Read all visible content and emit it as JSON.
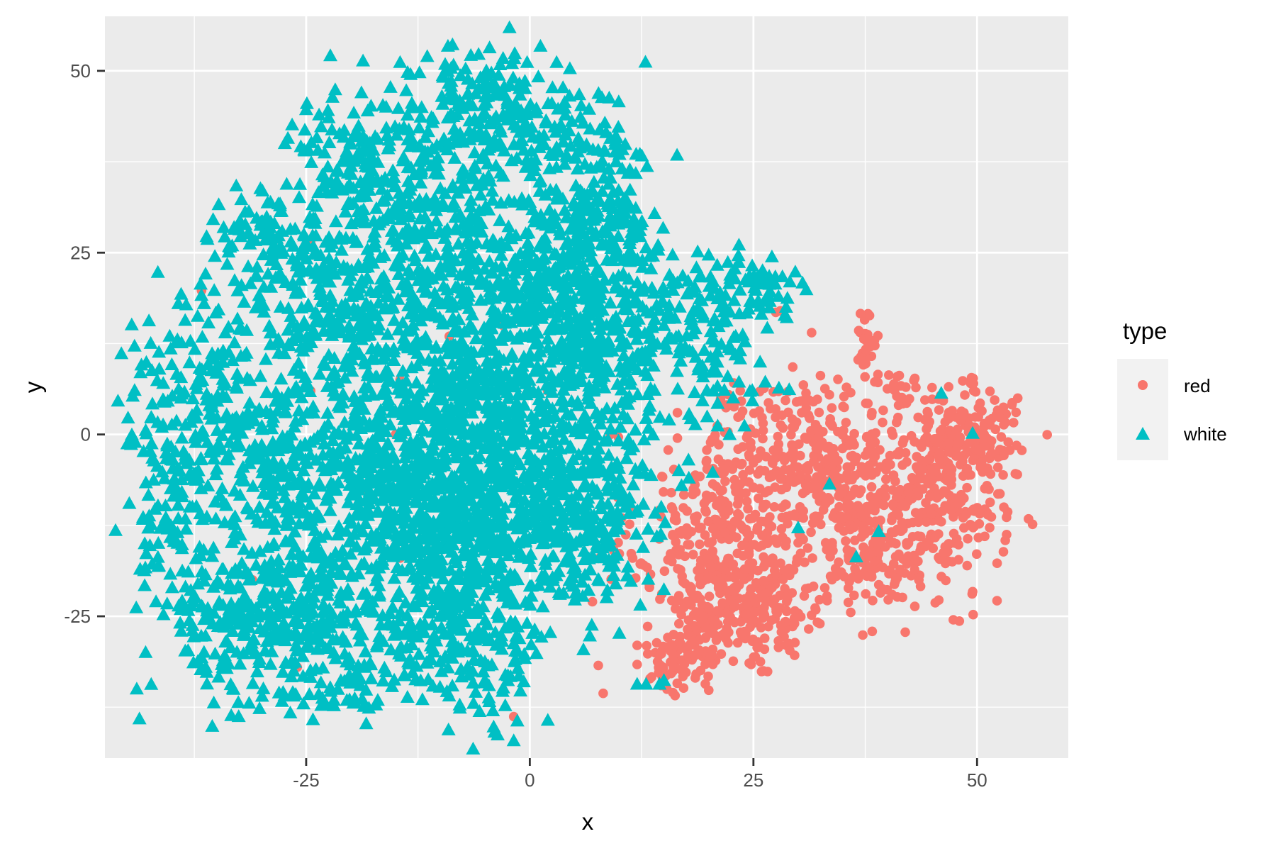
{
  "chart_data": {
    "type": "scatter",
    "title": "",
    "xlabel": "x",
    "ylabel": "y",
    "xlim": [
      -47.5,
      60.2
    ],
    "ylim": [
      -44.5,
      57.5
    ],
    "x_ticks": [
      -25,
      0,
      25,
      50
    ],
    "y_ticks": [
      -25,
      0,
      25,
      50
    ],
    "x_tick_labels": [
      "-25",
      "0",
      "25",
      "50"
    ],
    "y_tick_labels": [
      "-25",
      "0",
      "25",
      "50"
    ],
    "grid": true,
    "legend": {
      "title": "type",
      "placement": "right",
      "entries": [
        {
          "label": "red",
          "shape": "circle",
          "color": "#F8766D"
        },
        {
          "label": "white",
          "shape": "triangle",
          "color": "#00BFC4"
        }
      ]
    },
    "colors": {
      "red": "#F8766D",
      "white": "#00BFC4",
      "panel": "#EBEBEB",
      "grid": "#FFFFFF"
    },
    "series": [
      {
        "name": "red",
        "shape": "circle",
        "approx_count": 1599,
        "clusters": [
          {
            "cx": 22,
            "cy": -14,
            "sx": 5,
            "sy": 7,
            "n": 330
          },
          {
            "cx": 24,
            "cy": -24,
            "sx": 4.5,
            "sy": 4,
            "n": 200
          },
          {
            "cx": 30,
            "cy": -2,
            "sx": 5,
            "sy": 5,
            "n": 210
          },
          {
            "cx": 36,
            "cy": -9,
            "sx": 4,
            "sy": 6,
            "n": 200
          },
          {
            "cx": 46,
            "cy": -8,
            "sx": 3.5,
            "sy": 6.5,
            "n": 260
          },
          {
            "cx": 50,
            "cy": 0,
            "sx": 3,
            "sy": 3,
            "n": 110
          },
          {
            "cx": 40,
            "cy": -18,
            "sx": 3.5,
            "sy": 3,
            "n": 90
          },
          {
            "cx": 37.5,
            "cy": 13,
            "sx": 0.8,
            "sy": 2.2,
            "n": 25
          },
          {
            "cx": 41,
            "cy": 6,
            "sx": 2,
            "sy": 1.6,
            "n": 25
          },
          {
            "cx": 18,
            "cy": -30,
            "sx": 2.5,
            "sy": 2,
            "n": 70
          },
          {
            "cx": 15,
            "cy": -33,
            "sx": 1,
            "sy": 1.5,
            "n": 15
          }
        ],
        "outliers": [
          [
            -1.8,
            -38.8
          ],
          [
            7,
            -23
          ],
          [
            11.5,
            -17
          ],
          [
            12,
            -29
          ],
          [
            16.5,
            3
          ],
          [
            16.5,
            -0.5
          ],
          [
            31.5,
            14
          ],
          [
            28,
            17
          ],
          [
            27.5,
            16.8
          ],
          [
            40.5,
            -22
          ],
          [
            46,
            -12
          ],
          [
            53,
            -10
          ],
          [
            54.5,
            -5.5
          ],
          [
            -36.7,
            19.8
          ],
          [
            -24.5,
            26.5
          ],
          [
            -24.5,
            6
          ],
          [
            -14.5,
            7.5
          ],
          [
            -9,
            13.5
          ],
          [
            -14.5,
            -17
          ],
          [
            -4.5,
            -12.5
          ],
          [
            -8.5,
            -23
          ],
          [
            -11,
            -17
          ],
          [
            -31,
            -20
          ],
          [
            -26,
            -32
          ],
          [
            16,
            -35.5
          ],
          [
            2,
            6
          ],
          [
            -15,
            0
          ],
          [
            -18,
            -8
          ],
          [
            -3,
            15
          ],
          [
            9,
            0
          ]
        ]
      },
      {
        "name": "white",
        "shape": "triangle",
        "approx_count": 4898,
        "clusters": [
          {
            "cx": -6,
            "cy": 44,
            "sx": 6,
            "sy": 5,
            "n": 220
          },
          {
            "cx": -20,
            "cy": 38,
            "sx": 4,
            "sy": 4,
            "n": 90
          },
          {
            "cx": 6,
            "cy": 36,
            "sx": 4,
            "sy": 5,
            "n": 110
          },
          {
            "cx": 8,
            "cy": 28,
            "sx": 3,
            "sy": 3,
            "n": 90
          },
          {
            "cx": -12,
            "cy": 28,
            "sx": 8,
            "sy": 6,
            "n": 330
          },
          {
            "cx": -30,
            "cy": 27,
            "sx": 4,
            "sy": 3,
            "n": 80
          },
          {
            "cx": 3,
            "cy": 22,
            "sx": 5,
            "sy": 4,
            "n": 180
          },
          {
            "cx": -20,
            "cy": 16,
            "sx": 6,
            "sy": 6,
            "n": 260
          },
          {
            "cx": -2,
            "cy": 13,
            "sx": 7,
            "sy": 5,
            "n": 280
          },
          {
            "cx": 10,
            "cy": 12,
            "sx": 4,
            "sy": 5,
            "n": 160
          },
          {
            "cx": -35,
            "cy": 5,
            "sx": 5,
            "sy": 7,
            "n": 200
          },
          {
            "cx": -10,
            "cy": -3,
            "sx": 8,
            "sy": 6,
            "n": 520
          },
          {
            "cx": 5,
            "cy": -6,
            "sx": 5,
            "sy": 6,
            "n": 260
          },
          {
            "cx": -25,
            "cy": -5,
            "sx": 6,
            "sy": 6,
            "n": 240
          },
          {
            "cx": -40,
            "cy": -12,
            "sx": 2.5,
            "sy": 7,
            "n": 90
          },
          {
            "cx": -28,
            "cy": -25,
            "sx": 6,
            "sy": 6,
            "n": 420
          },
          {
            "cx": -8,
            "cy": -25,
            "sx": 5,
            "sy": 7,
            "n": 380
          },
          {
            "cx": -8,
            "cy": -12,
            "sx": 7,
            "sy": 5,
            "n": 300
          },
          {
            "cx": 6,
            "cy": -17,
            "sx": 3,
            "sy": 4,
            "n": 80
          },
          {
            "cx": 20,
            "cy": 10,
            "sx": 3,
            "sy": 4,
            "n": 70
          },
          {
            "cx": 25,
            "cy": 20,
            "sx": 2.5,
            "sy": 3,
            "n": 60
          },
          {
            "cx": 18,
            "cy": 19,
            "sx": 3,
            "sy": 2.5,
            "n": 40
          },
          {
            "cx": -20,
            "cy": -35,
            "sx": 3,
            "sy": 2,
            "n": 30
          },
          {
            "cx": -5,
            "cy": 5,
            "sx": 4,
            "sy": 3,
            "n": 120
          }
        ],
        "outliers": [
          [
            -44,
            -24
          ],
          [
            -36.8,
            20.5
          ],
          [
            -33,
            21
          ],
          [
            -25,
            44.5
          ],
          [
            -14.5,
            51
          ],
          [
            -4.5,
            53
          ],
          [
            -0.3,
            51
          ],
          [
            3,
            51
          ],
          [
            13,
            25.5
          ],
          [
            20,
            24.5
          ],
          [
            29,
            6
          ],
          [
            33.5,
            -7
          ],
          [
            30,
            -13
          ],
          [
            39,
            -13.5
          ],
          [
            36.5,
            -17
          ],
          [
            46,
            5.5
          ],
          [
            49.5,
            0
          ],
          [
            14,
            -11
          ],
          [
            13,
            -34.5
          ],
          [
            14.5,
            -34.5
          ],
          [
            12,
            -34.5
          ],
          [
            15,
            -34
          ],
          [
            15,
            -21.5
          ],
          [
            10,
            -27.5
          ],
          [
            24,
            1
          ],
          [
            18,
            2
          ],
          [
            21,
            1
          ],
          [
            8,
            12
          ]
        ]
      }
    ]
  }
}
